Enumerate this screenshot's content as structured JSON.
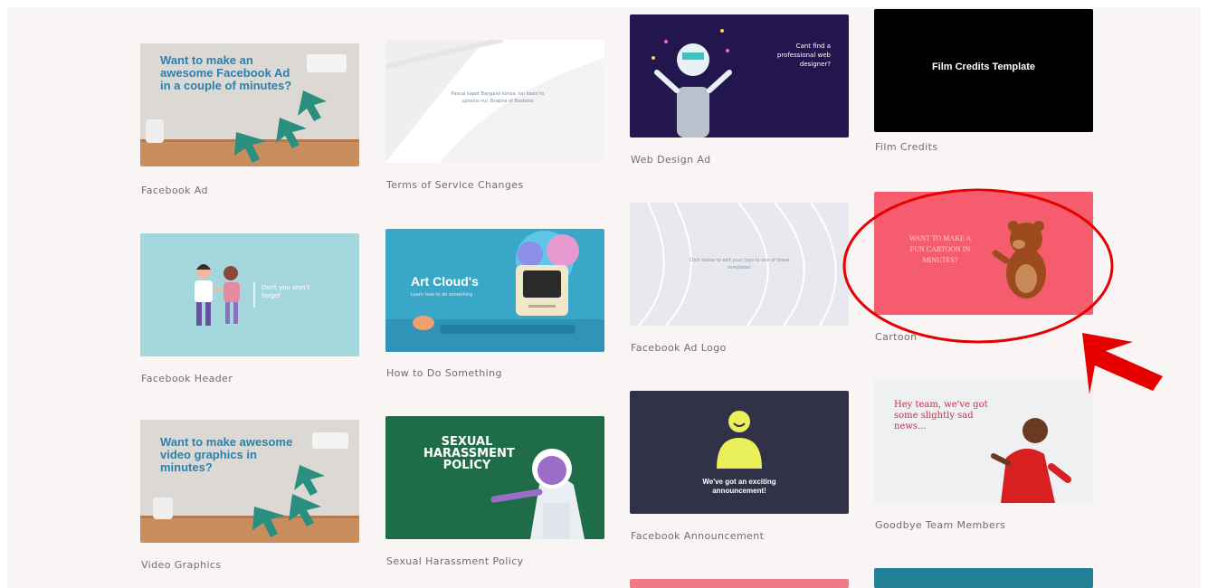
{
  "templates": [
    {
      "title": "Facebook Ad",
      "headline": "Want to make an awesome Facebook Ad in a couple of minutes?"
    },
    {
      "title": "Terms of Service Changes",
      "body": "Pascal kapot Bangalvi konsa, lon kasol to upsalos nui, Bsapna of Bastelos"
    },
    {
      "title": "Web Design Ad",
      "text": "Cant find a professional web designer?"
    },
    {
      "title": "Film Credits",
      "text": "Film Credits Template"
    },
    {
      "title": "Facebook Header",
      "text": "Dont you won't forget"
    },
    {
      "title": "How to Do Something",
      "headline": "Art Cloud's",
      "subtext": "Learn how to do something"
    },
    {
      "title": "Facebook Ad Logo",
      "text": "Click below to edit your logo to one of these templates"
    },
    {
      "title": "Cartoon",
      "text": "WANT TO MAKE A FUN CARTOON IN MINUTES?"
    },
    {
      "title": "Video Graphics",
      "headline": "Want to make awesome video graphics in minutes?"
    },
    {
      "title": "Sexual Harassment Policy",
      "headline": "SEXUAL HARASSMENT POLICY"
    },
    {
      "title": "Facebook Announcement",
      "text": "We've got an exciting announcement!"
    },
    {
      "title": "Goodbye Team Members",
      "text": "Hey team, we've got some slightly sad news..."
    }
  ],
  "annotation": {
    "shape": "ellipse",
    "arrow": "diagonal-arrow",
    "color": "#e60000"
  }
}
